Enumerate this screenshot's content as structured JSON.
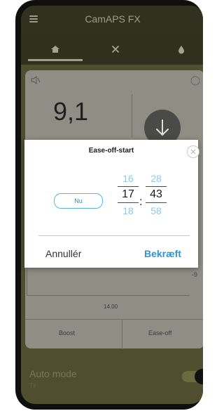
{
  "app": {
    "title": "CamAPS FX"
  },
  "tabs": [
    {
      "name": "home",
      "icon": "home-icon"
    },
    {
      "name": "tools",
      "icon": "tools-icon"
    },
    {
      "name": "insulin",
      "icon": "drop-icon"
    }
  ],
  "main": {
    "value": "9,1",
    "chart_time_label": "14.00",
    "chart_side_label": "-9",
    "actions": {
      "boost": "Boost",
      "ease_off": "Ease-off"
    },
    "auto_mode": {
      "label": "Auto mode",
      "sub": "Til"
    }
  },
  "dialog": {
    "title": "Ease-off-start",
    "now_button": "Nu",
    "hours": {
      "prev": "16",
      "selected": "17",
      "next": "18"
    },
    "minutes": {
      "prev": "28",
      "selected": "43",
      "next": "58"
    },
    "separator": ":",
    "cancel": "Annullér",
    "confirm": "Bekræft"
  },
  "colors": {
    "accent": "#2b95d8",
    "picker_dim": "#8ec9ec",
    "overlay_bg": "#4f4f2f"
  }
}
